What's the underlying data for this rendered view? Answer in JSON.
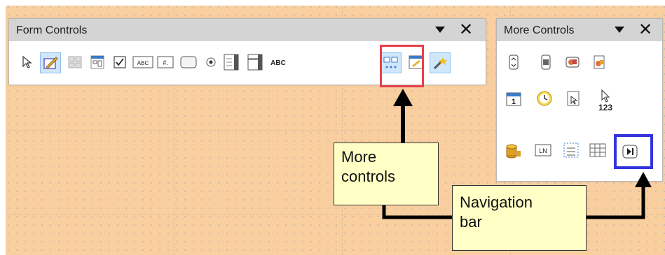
{
  "form_controls": {
    "title": "Form Controls",
    "icons": [
      "select-icon",
      "design-mode-icon",
      "control-properties-icon",
      "form-properties-icon",
      "check-box-icon",
      "text-box-icon",
      "formatted-field-icon",
      "push-button-icon",
      "option-button-icon",
      "list-box-icon",
      "combo-box-icon",
      "label-field-icon",
      "more-controls-icon",
      "form-design-icon",
      "wizards-icon"
    ],
    "text_box_label": "ABC",
    "label_field_label": "ABC"
  },
  "more_controls": {
    "title": "More Controls",
    "numeric_field_label": "123",
    "line_numbers_label": "LN"
  },
  "callouts": {
    "more_controls": "More controls",
    "more_controls_line1": "More",
    "more_controls_line2": "controls",
    "navigation_bar_line1": "Navigation",
    "navigation_bar_line2": "bar"
  },
  "colors": {
    "background": "#f9cfa0",
    "callout_fill": "#ffffc6",
    "red_highlight": "#e8404a",
    "blue_highlight": "#3333dd"
  }
}
